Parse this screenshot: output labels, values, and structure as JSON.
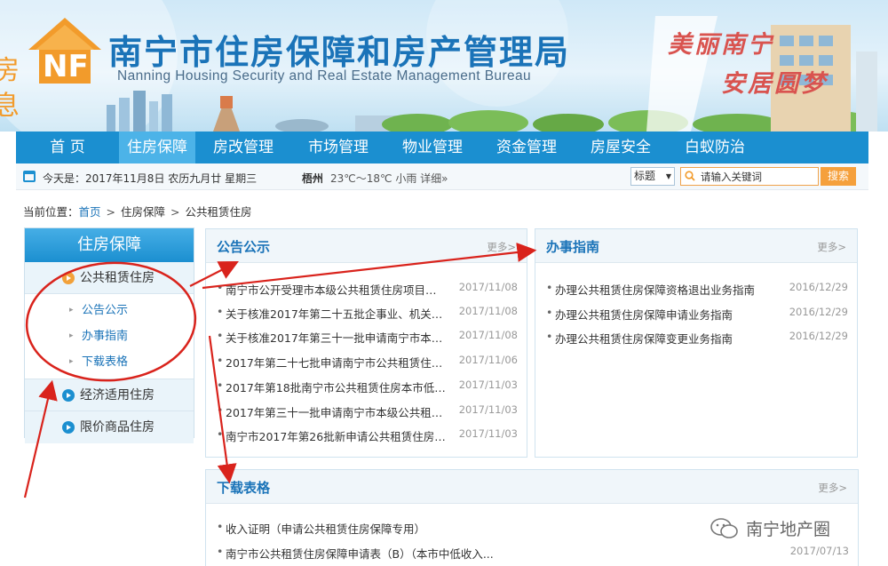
{
  "colors": {
    "nav_bg": "#1b8fd0",
    "nav_active": "#4cb3e8",
    "link": "#1a73b8",
    "accent_orange": "#f5a03c",
    "annotation_red": "#d9231c"
  },
  "banner": {
    "logo_icon": "house-nf-logo-icon",
    "title": "南宁市住房保障和房产管理局",
    "subtitle": "Nanning Housing Security and Real Estate Management Bureau",
    "left_deco_chars": [
      "房",
      "息"
    ],
    "slogan_line1": "美丽南宁",
    "slogan_line2": "安居圆梦"
  },
  "nav": {
    "items": [
      {
        "label": "首 页"
      },
      {
        "label": "住房保障",
        "active": true
      },
      {
        "label": "房改管理"
      },
      {
        "label": "市场管理"
      },
      {
        "label": "物业管理"
      },
      {
        "label": "资金管理"
      },
      {
        "label": "房屋安全"
      },
      {
        "label": "白蚁防治"
      }
    ]
  },
  "infobar": {
    "date_text": "今天是：2017年11月8日  农历九月廿  星期三",
    "weather_city": "梧州",
    "weather_text": "23℃～18℃ 小雨 详细»",
    "category_select": "标题",
    "search_placeholder": "请输入关键词",
    "search_button": "搜索"
  },
  "breadcrumb": {
    "prefix": "当前位置：",
    "items": [
      "首页",
      "住房保障",
      "公共租赁住房"
    ]
  },
  "sidebar": {
    "title": "住房保障",
    "main_active": "公共租赁住房",
    "sub_items": [
      "公告公示",
      "办事指南",
      "下载表格"
    ],
    "other_items": [
      "经济适用住房",
      "限价商品住房"
    ]
  },
  "panel_notice": {
    "title": "公告公示",
    "more": "更多>",
    "items": [
      {
        "title": "南宁市公开受理市本级公共租赁住房项目…",
        "date": "2017/11/08"
      },
      {
        "title": "关于核准2017年第二十五批企事业、机关…",
        "date": "2017/11/08"
      },
      {
        "title": "关于核准2017年第三十一批申请南宁市本…",
        "date": "2017/11/08"
      },
      {
        "title": "2017年第二十七批申请南宁市公共租赁住…",
        "date": "2017/11/06"
      },
      {
        "title": "2017年第18批南宁市公共租赁住房本市低…",
        "date": "2017/11/03"
      },
      {
        "title": "2017年第三十一批申请南宁市本级公共租…",
        "date": "2017/11/03"
      },
      {
        "title": "南宁市2017年第26批新申请公共租赁住房…",
        "date": "2017/11/03"
      }
    ]
  },
  "panel_guide": {
    "title": "办事指南",
    "more": "更多>",
    "items": [
      {
        "title": "办理公共租赁住房保障资格退出业务指南",
        "date": "2016/12/29"
      },
      {
        "title": "办理公共租赁住房保障申请业务指南",
        "date": "2016/12/29"
      },
      {
        "title": "办理公共租赁住房保障变更业务指南",
        "date": "2016/12/29"
      }
    ]
  },
  "panel_download": {
    "title": "下载表格",
    "more": "更多>",
    "items": [
      {
        "title": "收入证明（申请公共租赁住房保障专用）",
        "date": ""
      },
      {
        "title": "南宁市公共租赁住房保障申请表（B）（本市中低收入...",
        "date": "2017/07/13"
      }
    ]
  },
  "watermark": {
    "icon": "wechat-icon",
    "text": "南宁地产圈"
  }
}
